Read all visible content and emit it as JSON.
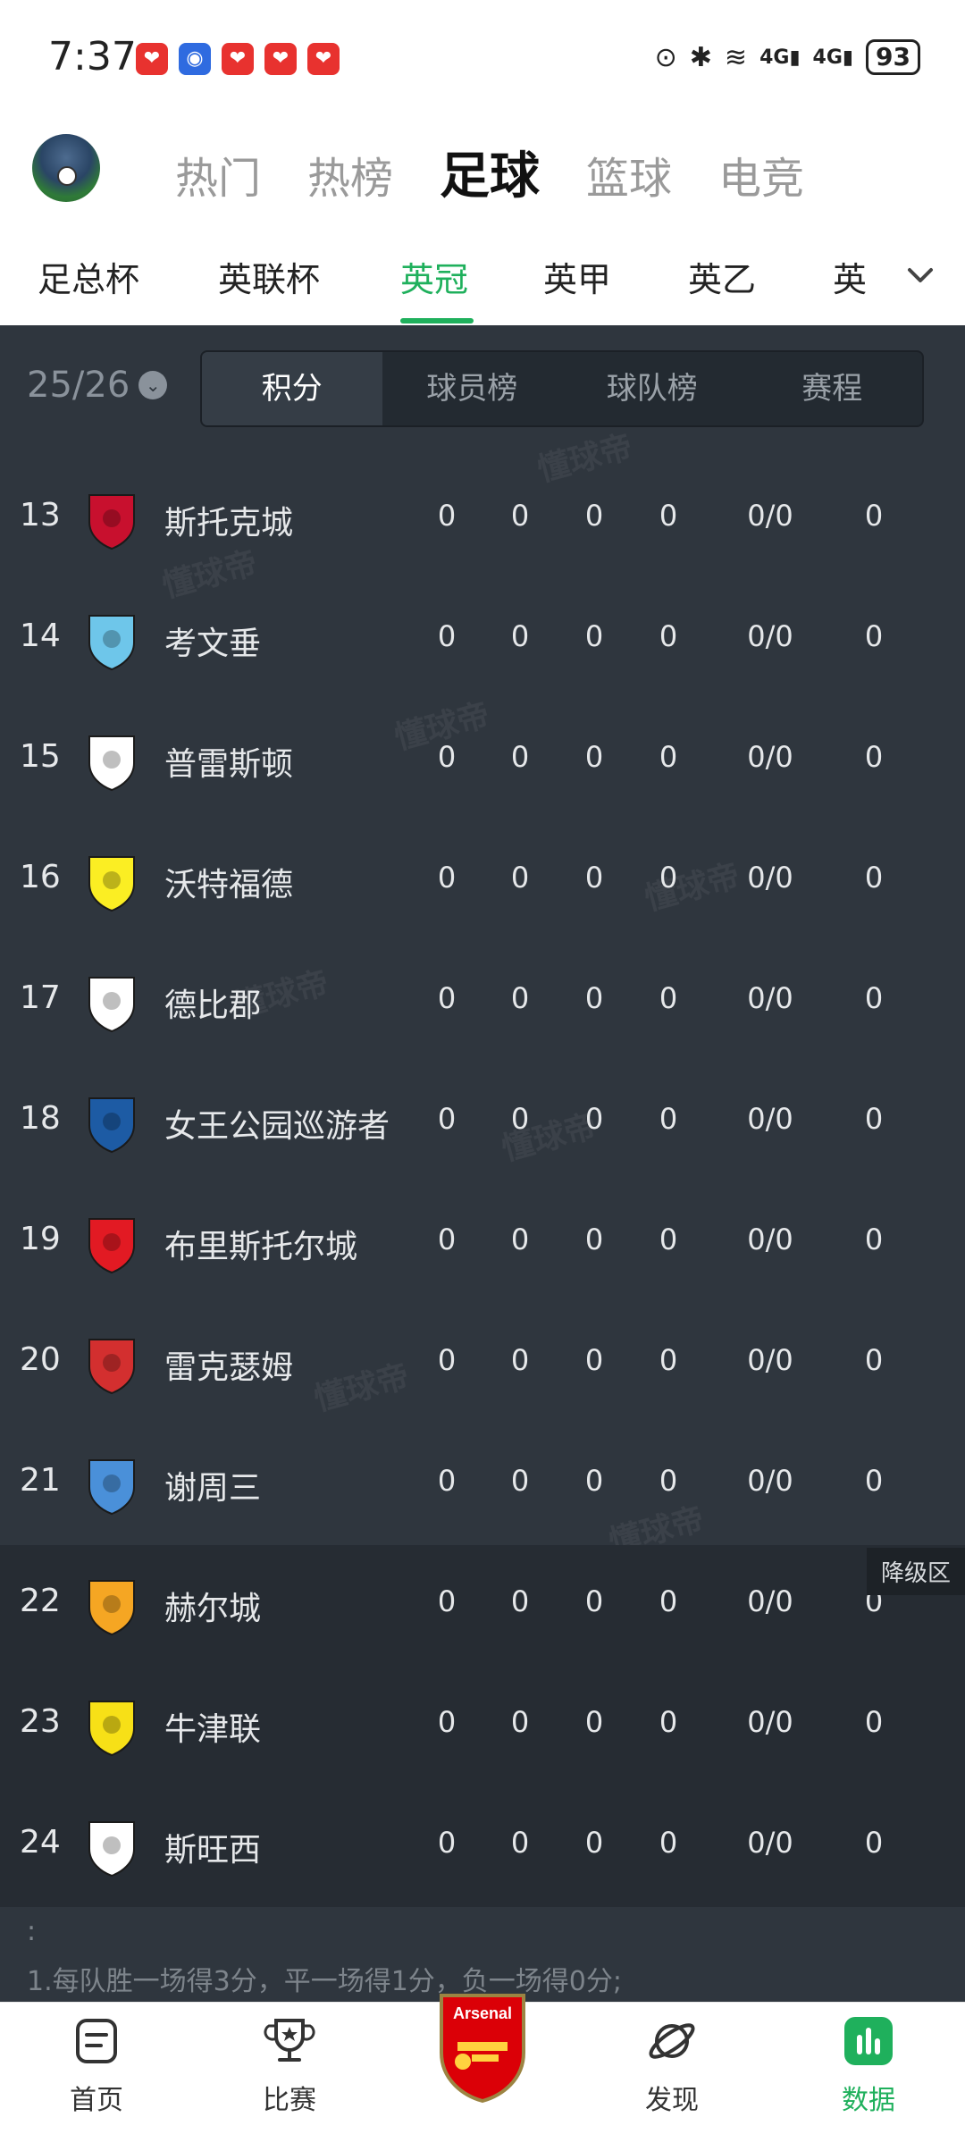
{
  "status_bar": {
    "time": "7:37",
    "network_1": "4G",
    "network_2": "4G",
    "battery": "93"
  },
  "header": {
    "tabs": [
      {
        "label": "热门"
      },
      {
        "label": "热榜"
      },
      {
        "label": "足球"
      },
      {
        "label": "篮球"
      },
      {
        "label": "电竞"
      }
    ],
    "active_tab": "足球"
  },
  "leagues": {
    "tabs": [
      {
        "label": "足总杯"
      },
      {
        "label": "英联杯"
      },
      {
        "label": "英冠"
      },
      {
        "label": "英甲"
      },
      {
        "label": "英乙"
      },
      {
        "label": "英"
      }
    ],
    "active": "英冠"
  },
  "filters": {
    "season": "25/26",
    "segments": [
      {
        "label": "积分"
      },
      {
        "label": "球员榜"
      },
      {
        "label": "球队榜"
      },
      {
        "label": "赛程"
      }
    ],
    "active_segment": "积分"
  },
  "standings": [
    {
      "rank": "13",
      "team": "斯托克城",
      "p": "0",
      "w": "0",
      "d": "0",
      "l": "0",
      "goals": "0/0",
      "pts": "0",
      "crest_color": "#c8102e"
    },
    {
      "rank": "14",
      "team": "考文垂",
      "p": "0",
      "w": "0",
      "d": "0",
      "l": "0",
      "goals": "0/0",
      "pts": "0",
      "crest_color": "#6ec6ea"
    },
    {
      "rank": "15",
      "team": "普雷斯顿",
      "p": "0",
      "w": "0",
      "d": "0",
      "l": "0",
      "goals": "0/0",
      "pts": "0",
      "crest_color": "#ffffff"
    },
    {
      "rank": "16",
      "team": "沃特福德",
      "p": "0",
      "w": "0",
      "d": "0",
      "l": "0",
      "goals": "0/0",
      "pts": "0",
      "crest_color": "#fbee23"
    },
    {
      "rank": "17",
      "team": "德比郡",
      "p": "0",
      "w": "0",
      "d": "0",
      "l": "0",
      "goals": "0/0",
      "pts": "0",
      "crest_color": "#ffffff"
    },
    {
      "rank": "18",
      "team": "女王公园巡游者",
      "p": "0",
      "w": "0",
      "d": "0",
      "l": "0",
      "goals": "0/0",
      "pts": "0",
      "crest_color": "#1d5ba4"
    },
    {
      "rank": "19",
      "team": "布里斯托尔城",
      "p": "0",
      "w": "0",
      "d": "0",
      "l": "0",
      "goals": "0/0",
      "pts": "0",
      "crest_color": "#e21a23"
    },
    {
      "rank": "20",
      "team": "雷克瑟姆",
      "p": "0",
      "w": "0",
      "d": "0",
      "l": "0",
      "goals": "0/0",
      "pts": "0",
      "crest_color": "#d32f2f"
    },
    {
      "rank": "21",
      "team": "谢周三",
      "p": "0",
      "w": "0",
      "d": "0",
      "l": "0",
      "goals": "0/0",
      "pts": "0",
      "crest_color": "#4a90d9"
    },
    {
      "rank": "22",
      "team": "赫尔城",
      "p": "0",
      "w": "0",
      "d": "0",
      "l": "0",
      "goals": "0/0",
      "pts": "0",
      "crest_color": "#f5a623"
    },
    {
      "rank": "23",
      "team": "牛津联",
      "p": "0",
      "w": "0",
      "d": "0",
      "l": "0",
      "goals": "0/0",
      "pts": "0",
      "crest_color": "#f7e017"
    },
    {
      "rank": "24",
      "team": "斯旺西",
      "p": "0",
      "w": "0",
      "d": "0",
      "l": "0",
      "goals": "0/0",
      "pts": "0",
      "crest_color": "#ffffff"
    }
  ],
  "relegation_label": "降级区",
  "legend": {
    "line1": ":",
    "line2": "1.每队胜一场得3分，平一场得1分，负一场得0分;"
  },
  "watermark": "懂球帝",
  "bottom_nav": [
    {
      "label": "首页"
    },
    {
      "label": "比赛"
    },
    {
      "label": "Arsenal"
    },
    {
      "label": "发现"
    },
    {
      "label": "数据"
    }
  ],
  "active_nav": "数据"
}
